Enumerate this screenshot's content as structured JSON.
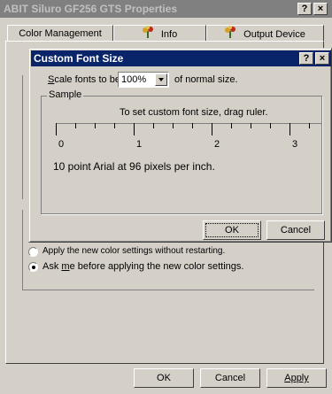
{
  "outer_window": {
    "title": "ABIT Siluro GF256 GTS Properties",
    "help_btn": "?",
    "close_btn": "×"
  },
  "tabs": [
    {
      "label": "Color Management"
    },
    {
      "label": "Info",
      "icon": "plant-icon"
    },
    {
      "label": "Output Device",
      "icon": "plant-icon"
    }
  ],
  "options": {
    "apply_without_restart": "Apply the new color settings without restarting.",
    "ask_me": "Ask me before applying the new color settings.",
    "ask_me_pre": "Ask ",
    "ask_me_accel": "m",
    "ask_me_post": "e before applying the new color settings."
  },
  "footer": {
    "ok": "OK",
    "cancel": "Cancel",
    "apply": "Apply"
  },
  "dialog": {
    "title": "Custom Font Size",
    "help_btn": "?",
    "close_btn": "×",
    "scale_prefix_accel": "S",
    "scale_prefix_rest": "cale fonts to be",
    "scale_value": "100%",
    "scale_suffix": "of normal size.",
    "sample_label": "Sample",
    "instruction": "To set custom font size, drag ruler.",
    "ruler_labels": [
      "0",
      "1",
      "2",
      "3"
    ],
    "sample_text": "10 point Arial at 96 pixels per inch.",
    "ok": "OK",
    "cancel": "Cancel"
  },
  "colors": {
    "face": "#d4d0c8",
    "active_title": "#0a246a",
    "inactive_title": "#808080"
  }
}
